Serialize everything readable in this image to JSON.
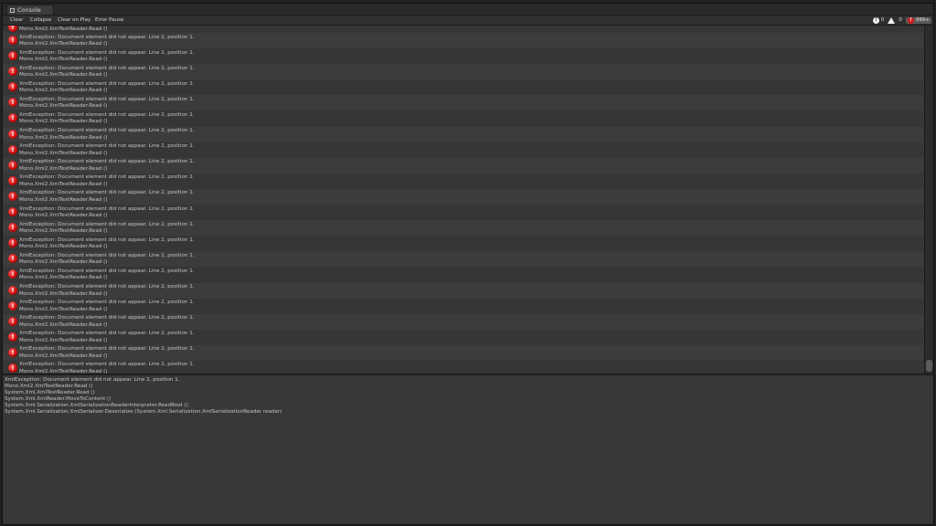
{
  "window": {
    "tab_label": "Console"
  },
  "toolbar": {
    "clear": "Clear",
    "collapse": "Collapse",
    "clear_on_play": "Clear on Play",
    "error_pause": "Error Pause",
    "info_count": "0",
    "warning_count": "0",
    "error_count": "999+"
  },
  "log": {
    "first_partial_line": "Mono.Xml2.XmlTextReader.Read ()",
    "entries": [
      {
        "line1": "XmlException: Document element did not appear.  Line 2, position 1.",
        "line2": "Mono.Xml2.XmlTextReader.Read ()"
      },
      {
        "line1": "XmlException: Document element did not appear.  Line 2, position 1.",
        "line2": "Mono.Xml2.XmlTextReader.Read ()"
      },
      {
        "line1": "XmlException: Document element did not appear.  Line 2, position 1.",
        "line2": "Mono.Xml2.XmlTextReader.Read ()"
      },
      {
        "line1": "XmlException: Document element did not appear.  Line 2, position 1.",
        "line2": "Mono.Xml2.XmlTextReader.Read ()"
      },
      {
        "line1": "XmlException: Document element did not appear.  Line 2, position 1.",
        "line2": "Mono.Xml2.XmlTextReader.Read ()"
      },
      {
        "line1": "XmlException: Document element did not appear.  Line 2, position 1.",
        "line2": "Mono.Xml2.XmlTextReader.Read ()"
      },
      {
        "line1": "XmlException: Document element did not appear.  Line 2, position 1.",
        "line2": "Mono.Xml2.XmlTextReader.Read ()"
      },
      {
        "line1": "XmlException: Document element did not appear.  Line 2, position 1.",
        "line2": "Mono.Xml2.XmlTextReader.Read ()"
      },
      {
        "line1": "XmlException: Document element did not appear.  Line 2, position 1.",
        "line2": "Mono.Xml2.XmlTextReader.Read ()"
      },
      {
        "line1": "XmlException: Document element did not appear.  Line 2, position 1.",
        "line2": "Mono.Xml2.XmlTextReader.Read ()"
      },
      {
        "line1": "XmlException: Document element did not appear.  Line 2, position 1.",
        "line2": "Mono.Xml2.XmlTextReader.Read ()"
      },
      {
        "line1": "XmlException: Document element did not appear.  Line 2, position 1.",
        "line2": "Mono.Xml2.XmlTextReader.Read ()"
      },
      {
        "line1": "XmlException: Document element did not appear.  Line 2, position 1.",
        "line2": "Mono.Xml2.XmlTextReader.Read ()"
      },
      {
        "line1": "XmlException: Document element did not appear.  Line 2, position 1.",
        "line2": "Mono.Xml2.XmlTextReader.Read ()"
      },
      {
        "line1": "XmlException: Document element did not appear.  Line 2, position 1.",
        "line2": "Mono.Xml2.XmlTextReader.Read ()"
      },
      {
        "line1": "XmlException: Document element did not appear.  Line 2, position 1.",
        "line2": "Mono.Xml2.XmlTextReader.Read ()"
      },
      {
        "line1": "XmlException: Document element did not appear.  Line 2, position 1.",
        "line2": "Mono.Xml2.XmlTextReader.Read ()"
      },
      {
        "line1": "XmlException: Document element did not appear.  Line 2, position 1.",
        "line2": "Mono.Xml2.XmlTextReader.Read ()"
      },
      {
        "line1": "XmlException: Document element did not appear.  Line 2, position 1.",
        "line2": "Mono.Xml2.XmlTextReader.Read ()"
      },
      {
        "line1": "XmlException: Document element did not appear.  Line 2, position 1.",
        "line2": "Mono.Xml2.XmlTextReader.Read ()"
      },
      {
        "line1": "XmlException: Document element did not appear.  Line 2, position 1.",
        "line2": "Mono.Xml2.XmlTextReader.Read ()"
      },
      {
        "line1": "XmlException: Document element did not appear.  Line 2, position 1.",
        "line2": "Mono.Xml2.XmlTextReader.Read ()"
      }
    ]
  },
  "detail": {
    "lines": [
      "XmlException: Document element did not appear.  Line 2, position 1.",
      "Mono.Xml2.XmlTextReader.Read ()",
      "System.Xml.XmlTextReader.Read ()",
      "System.Xml.XmlReader.MoveToContent ()",
      "System.Xml.Serialization.XmlSerializationReaderInterpreter.ReadRoot ()",
      "System.Xml.Serialization.XmlSerializer.Deserialize (System.Xml.Serialization.XmlSerializationReader reader)"
    ]
  },
  "colors": {
    "background": "#383838",
    "error_icon": "#d41c1c",
    "text": "#c4c4c4"
  }
}
